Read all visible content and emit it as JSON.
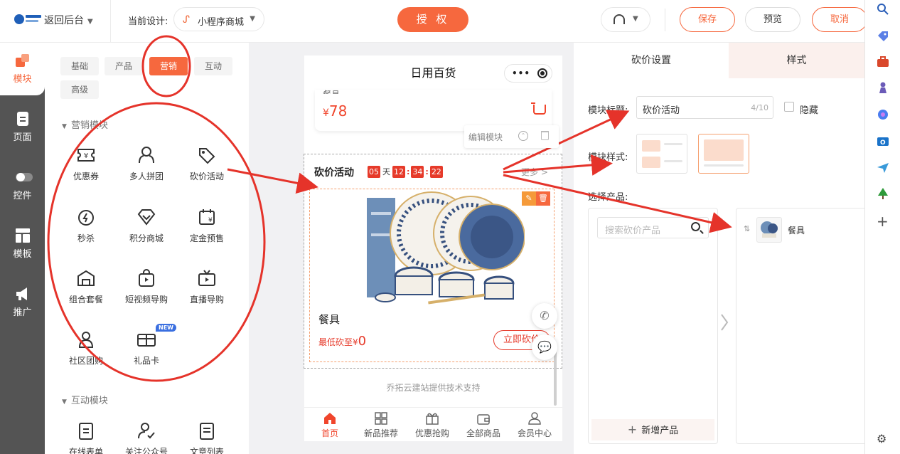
{
  "header": {
    "back_label": "返回后台",
    "design_label": "当前设计:",
    "design_value": "小程序商城",
    "authorize_label": "授 权",
    "save_label": "保存",
    "preview_label": "预览",
    "cancel_label": "取消"
  },
  "leftnav": {
    "items": [
      {
        "label": "模块",
        "icon": "blocks-icon"
      },
      {
        "label": "页面",
        "icon": "page-icon"
      },
      {
        "label": "控件",
        "icon": "toggle-icon"
      },
      {
        "label": "模板",
        "icon": "template-icon"
      },
      {
        "label": "推广",
        "icon": "megaphone-icon"
      }
    ]
  },
  "panel": {
    "tabs": [
      "基础",
      "产品",
      "营销",
      "互动",
      "高级"
    ],
    "active_tab": "营销",
    "section_marketing": "营销模块",
    "section_interaction": "互动模块",
    "components": [
      "优惠券",
      "多人拼团",
      "砍价活动",
      "秒杀",
      "积分商城",
      "定金预售",
      "组合套餐",
      "短视频导购",
      "直播导购",
      "社区团购",
      "礼品卡"
    ],
    "new_badge": "NEW",
    "interaction_components": [
      "在线表单",
      "关注公众号",
      "文章列表"
    ]
  },
  "phone": {
    "title": "日用百货",
    "prev_card_name": "餐具",
    "prev_price_symbol": "¥",
    "prev_price": "78",
    "edit_module": "编辑模块",
    "module_title": "砍价活动",
    "countdown": {
      "days": "05",
      "day_unit": "天",
      "h": "12",
      "m": "34",
      "s": "22"
    },
    "more": "更多 >",
    "product_name": "餐具",
    "lowest_label": "最低砍至",
    "lowest_symbol": "¥",
    "lowest_value": "0",
    "bargain_btn": "立即砍价",
    "support": "乔拓云建站提供技术支持",
    "tabbar": [
      "首页",
      "新品推荐",
      "优惠抢购",
      "全部商品",
      "会员中心"
    ]
  },
  "settings": {
    "tabs": [
      "砍价设置",
      "样式"
    ],
    "title_label": "模块标题:",
    "title_value": "砍价活动",
    "title_count": "4/10",
    "hide_label": "隐藏",
    "style_label": "模块样式:",
    "product_label": "选择产品:",
    "search_placeholder": "搜索砍价产品",
    "add_product": "新增产品",
    "selected_product": "餐具"
  },
  "colors": {
    "accent": "#f6683e",
    "price_red": "#f0452c",
    "annotation_red": "#e5332a"
  }
}
